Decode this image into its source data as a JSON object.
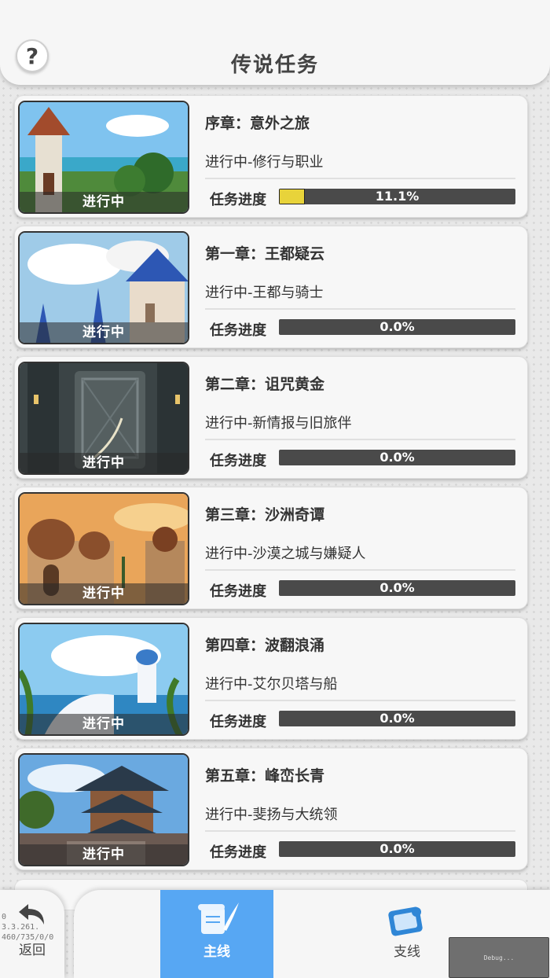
{
  "header": {
    "title": "传说任务",
    "help_label": "?"
  },
  "quests": [
    {
      "title": "序章：意外之旅",
      "subtitle": "进行中-修行与职业",
      "status": "进行中",
      "progress_label": "任务进度",
      "progress": 0.111,
      "progress_text": "11.1%",
      "theme": "tower"
    },
    {
      "title": "第一章：王都疑云",
      "subtitle": "进行中-王都与骑士",
      "status": "进行中",
      "progress_label": "任务进度",
      "progress": 0,
      "progress_text": "0.0%",
      "theme": "castle"
    },
    {
      "title": "第二章：诅咒黄金",
      "subtitle": "进行中-新情报与旧旅伴",
      "status": "进行中",
      "progress_label": "任务进度",
      "progress": 0,
      "progress_text": "0.0%",
      "theme": "vault"
    },
    {
      "title": "第三章：沙洲奇谭",
      "subtitle": "进行中-沙漠之城与嫌疑人",
      "status": "进行中",
      "progress_label": "任务进度",
      "progress": 0,
      "progress_text": "0.0%",
      "theme": "desert"
    },
    {
      "title": "第四章：波翻浪涌",
      "subtitle": "进行中-艾尔贝塔与船",
      "status": "进行中",
      "progress_label": "任务进度",
      "progress": 0,
      "progress_text": "0.0%",
      "theme": "sea"
    },
    {
      "title": "第五章：峰峦长青",
      "subtitle": "进行中-斐扬与大统领",
      "status": "进行中",
      "progress_label": "任务进度",
      "progress": 0,
      "progress_text": "0.0%",
      "theme": "pagoda"
    }
  ],
  "nav": {
    "back_label": "返回",
    "main_label": "主线",
    "side_label": "支线"
  },
  "debug": {
    "overlay_text": "0\n3.3.261.\n460/735/0/0",
    "box_text": "Debug..."
  },
  "colors": {
    "accent": "#57a7f3",
    "progress_fill": "#e8d33a",
    "progress_track": "#4a4a4a"
  }
}
